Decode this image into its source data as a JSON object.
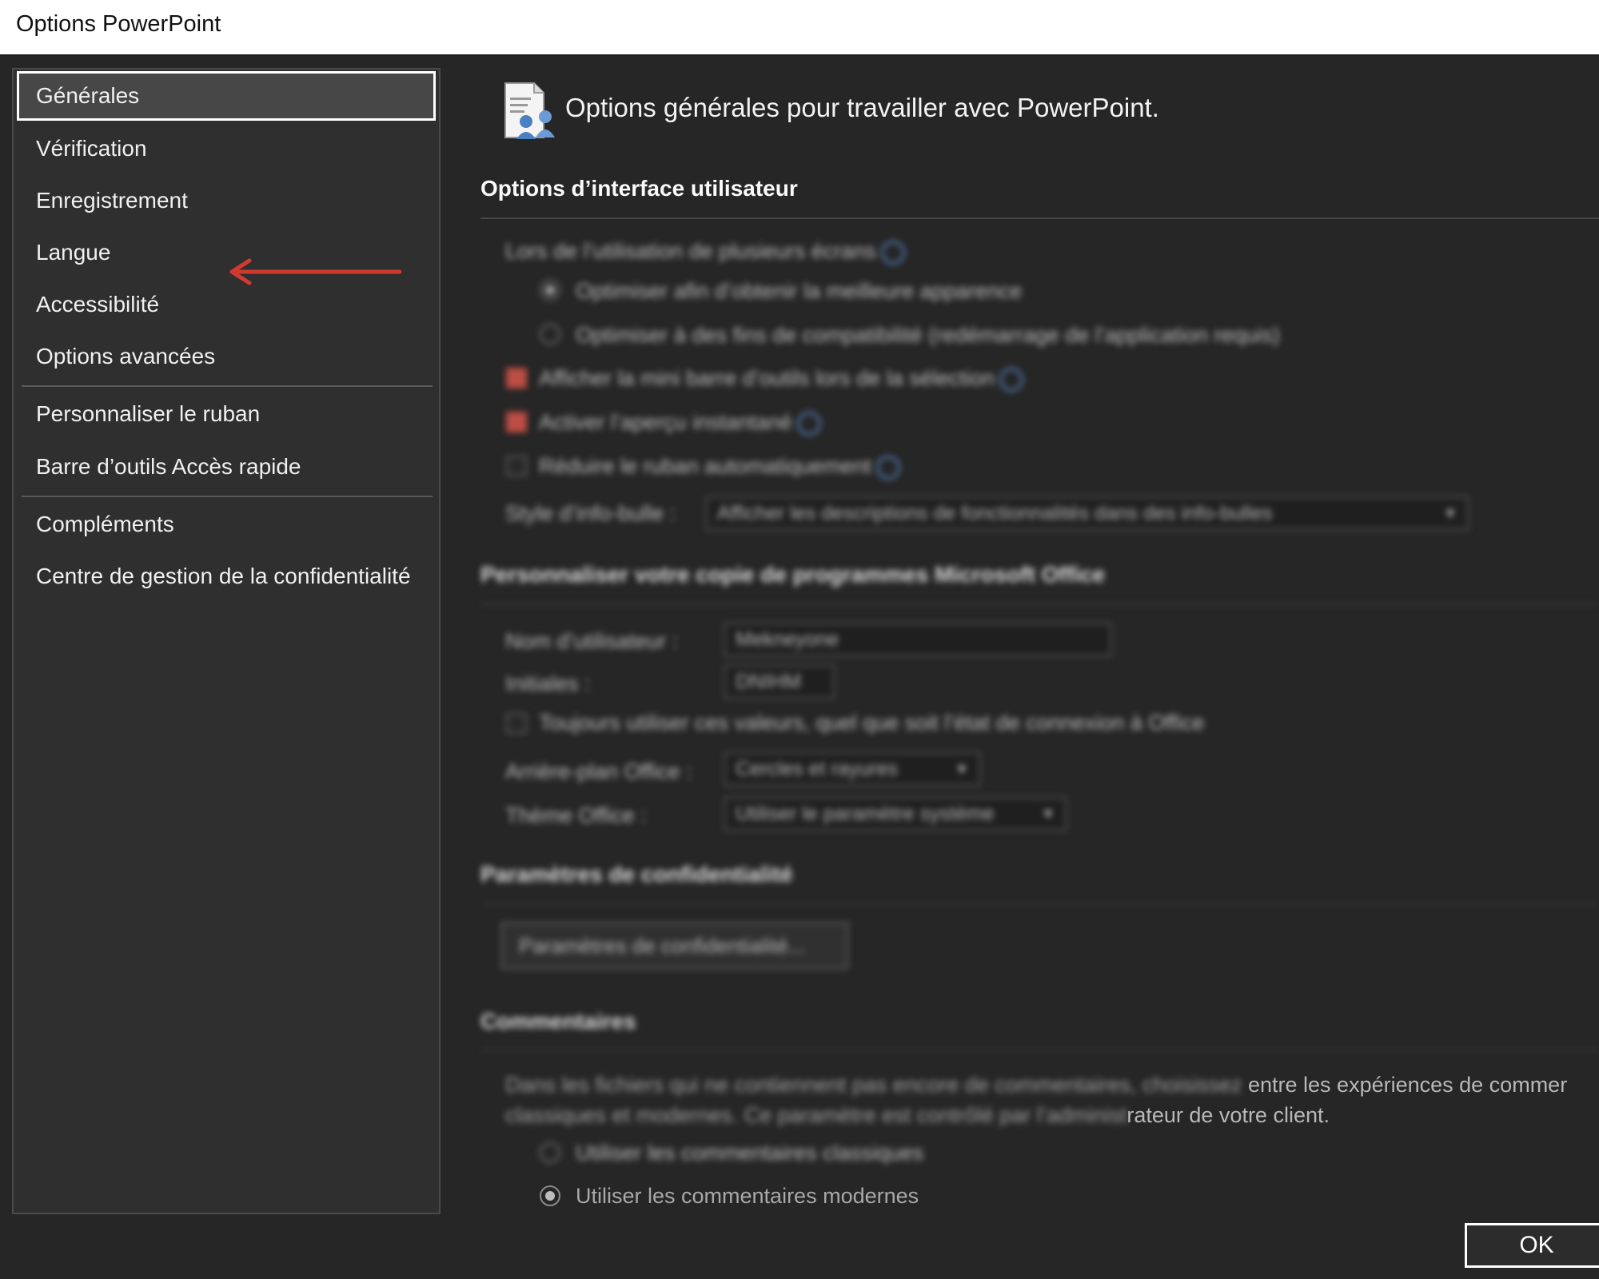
{
  "window": {
    "title": "Options PowerPoint"
  },
  "sidebar": {
    "items": [
      {
        "label": "Générales"
      },
      {
        "label": "Vérification"
      },
      {
        "label": "Enregistrement"
      },
      {
        "label": "Langue"
      },
      {
        "label": "Accessibilité"
      },
      {
        "label": "Options avancées"
      },
      {
        "label": "Personnaliser le ruban"
      },
      {
        "label": "Barre d’outils Accès rapide"
      },
      {
        "label": "Compléments"
      },
      {
        "label": "Centre de gestion de la confidentialité"
      }
    ],
    "selected_index": 0,
    "highlighted_item": "Enregistrement"
  },
  "main": {
    "header": {
      "title": "Options générales pour travailler avec PowerPoint."
    },
    "ui_options": {
      "title": "Options d’interface utilisateur",
      "multi_display_label": "Lors de l’utilisation de plusieurs écrans",
      "radio_optimize_appearance": "Optimiser afin d’obtenir la meilleure apparence",
      "radio_optimize_compat": "Optimiser à des fins de compatibilité (redémarrage de l’application requis)",
      "show_minibar": "Afficher la mini barre d’outils lors de la sélection",
      "live_preview": "Activer l’aperçu instantané",
      "collapse_ribbon": "Réduire le ruban automatiquement",
      "screentip_label": "Style d’info-bulle :",
      "screentip_value": "Afficher les descriptions de fonctionnalités dans des info-bulles"
    },
    "personalize": {
      "title": "Personnaliser votre copie de programmes Microsoft Office",
      "username_label": "Nom d’utilisateur :",
      "username_value": "Mekneyone",
      "initials_label": "Initiales :",
      "initials_value": "DNIHM",
      "always_use_values": "Toujours utiliser ces valeurs, quel que soit l’état de connexion à Office",
      "background_label": "Arrière-plan Office :",
      "background_value": "Cercles et rayures",
      "theme_label": "Thème Office :",
      "theme_value": "Utiliser le paramètre système"
    },
    "privacy": {
      "title": "Paramètres de confidentialité",
      "button_label": "Paramètres de confidentialité..."
    },
    "comments": {
      "title": "Commentaires",
      "line1_hidden": "Dans les fichiers qui ne contiennent pas encore de commentaires, choisissez",
      "line1_visible": "entre les expériences de commer",
      "line2_hidden": "classiques et modernes. Ce paramètre est contrôlé par l’administ",
      "line2_visible": "rateur de votre client.",
      "radio_classic": "Utiliser les commentaires classiques",
      "radio_modern": "Utiliser les commentaires modernes"
    }
  },
  "footer": {
    "ok_label": "OK"
  },
  "colors": {
    "background": "#262626",
    "sidebar": "#2f2f2f",
    "checkbox_checked": "#d9554b",
    "info_icon": "#5f8fd6",
    "arrow": "#d23a30"
  }
}
